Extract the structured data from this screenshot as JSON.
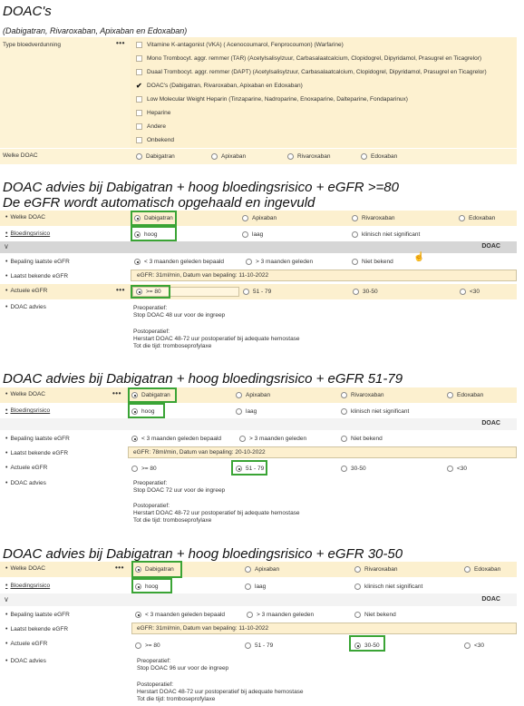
{
  "header": {
    "title": "DOAC's",
    "subtitle": "(Dabigatran, Rivaroxaban, Apixaban en Edoxaban)"
  },
  "form": {
    "type_label": "Type bloedverdunning",
    "type_options": [
      {
        "label": "Vitamine K-antagonist (VKA) ( Acenocoumarol, Fenprocoumon) (Warfarine)",
        "checked": false
      },
      {
        "label": "Mono Trombocyt. aggr. remmer (TAR) (Acetylsalisylzuur, Carbasalaatcalcium, Clopidogrel, Dipyridamol, Prasugrel en Ticagrelor)",
        "checked": false
      },
      {
        "label": "Duaal Trombocyt. aggr. remmer (DAPT) (Acetylsalisylzuur, Carbasalaatcalcium, Clopidogrel, Dipyridamol, Prasugrel en Ticagrelor)",
        "checked": false
      },
      {
        "label": "DOAC's (Dabigatran, Rivaroxaban, Apixaban en Edoxaban)",
        "checked": true
      },
      {
        "label": "Low Molecular Weight Heparin (Tinzaparine, Nadroparine, Enoxaparine, Dalteparine, Fondaparinux)",
        "checked": false
      },
      {
        "label": "Heparine",
        "checked": false
      },
      {
        "label": "Andere",
        "checked": false
      },
      {
        "label": "Onbekend",
        "checked": false
      }
    ],
    "welke_label": "Welke DOAC",
    "welke_options": [
      "Dabigatran",
      "Apixaban",
      "Rivaroxaban",
      "Edoxaban"
    ]
  },
  "sections": [
    {
      "title": "DOAC advies bij Dabigatran + hoog bloedingsrisico + eGFR >=80",
      "title2": "De eGFR wordt automatisch opgehaald en ingevuld",
      "welke_label": "Welke DOAC",
      "welke_options": [
        "Dabigatran",
        "Apixaban",
        "Rivaroxaban",
        "Edoxaban"
      ],
      "bleed_label": "Bloedingsrisico",
      "bleed_options": [
        "hoog",
        "laag",
        "klinisch niet significant"
      ],
      "group_title": "DOAC",
      "bepaling_label": "Bepaling laatste eGFR",
      "bepaling_options": [
        "< 3 maanden geleden bepaald",
        "> 3 maanden geleden",
        "Niet bekend"
      ],
      "laatst_label": "Laatst bekende eGFR",
      "laatst_value": "eGFR: 31ml/min, Datum van bepaling: 11-10-2022",
      "actueel_label": "Actuele eGFR",
      "actueel_options": [
        ">= 80",
        "51 - 79",
        "30-50",
        "<30"
      ],
      "advies_label": "DOAC advies",
      "advies_lines": [
        "Preoperatief:",
        "Stop DOAC 48 uur voor de ingreep",
        "",
        "Postoperatief:",
        "Herstart DOAC 48-72 uur postoperatief bij adequate hemostase",
        "Tot die tijd: tromboseprofylaxe"
      ]
    },
    {
      "title": "DOAC advies bij Dabigatran + hoog bloedingsrisico + eGFR 51-79",
      "welke_label": "Welke DOAC",
      "welke_options": [
        "Dabigatran",
        "Apixaban",
        "Rivaroxaban",
        "Edoxaban"
      ],
      "bleed_label": "Bloedingsrisico",
      "bleed_options": [
        "hoog",
        "laag",
        "klinisch niet significant"
      ],
      "group_title": "DOAC",
      "bepaling_label": "Bepaling laatste eGFR",
      "bepaling_options": [
        "< 3 maanden geleden bepaald",
        "> 3 maanden geleden",
        "Niet bekend"
      ],
      "laatst_label": "Laatst bekende eGFR",
      "laatst_value": "eGFR: 78ml/min, Datum van bepaling: 20-10-2022",
      "actueel_label": "Actuele eGFR",
      "actueel_options": [
        ">= 80",
        "51 - 79",
        "30-50",
        "<30"
      ],
      "advies_label": "DOAC advies",
      "advies_lines": [
        "Preoperatief:",
        "Stop DOAC 72 uur voor de ingreep",
        "",
        "Postoperatief:",
        "Herstart DOAC 48-72 uur postoperatief bij adequate hemostase",
        "Tot die tijd: tromboseprofylaxe"
      ]
    },
    {
      "title": "DOAC advies bij Dabigatran + hoog bloedingsrisico + eGFR 30-50",
      "welke_label": "Welke DOAC",
      "welke_options": [
        "Dabigatran",
        "Apixaban",
        "Rivaroxaban",
        "Edoxaban"
      ],
      "bleed_label": "Bloedingsrisico",
      "bleed_options": [
        "hoog",
        "laag",
        "klinisch niet significant"
      ],
      "group_title": "DOAC",
      "bepaling_label": "Bepaling laatste eGFR",
      "bepaling_options": [
        "< 3 maanden geleden bepaald",
        "> 3 maanden geleden",
        "Niet bekend"
      ],
      "laatst_label": "Laatst bekende eGFR",
      "laatst_value": "eGFR: 31ml/min, Datum van bepaling: 11-10-2022",
      "actueel_label": "Actuele eGFR",
      "actueel_options": [
        ">= 80",
        "51 - 79",
        "30-50",
        "<30"
      ],
      "advies_label": "DOAC advies",
      "advies_lines": [
        "Preoperatief:",
        "Stop DOAC 96 uur voor de ingreep",
        "",
        "Postoperatief:",
        "Herstart DOAC 48-72 uur postoperatief bij adequate hemostase",
        "Tot die tijd: tromboseprofylaxe"
      ]
    }
  ],
  "ui": {
    "more_glyph": "•••",
    "chevron_glyph": "∨",
    "check_glyph": "✔"
  }
}
